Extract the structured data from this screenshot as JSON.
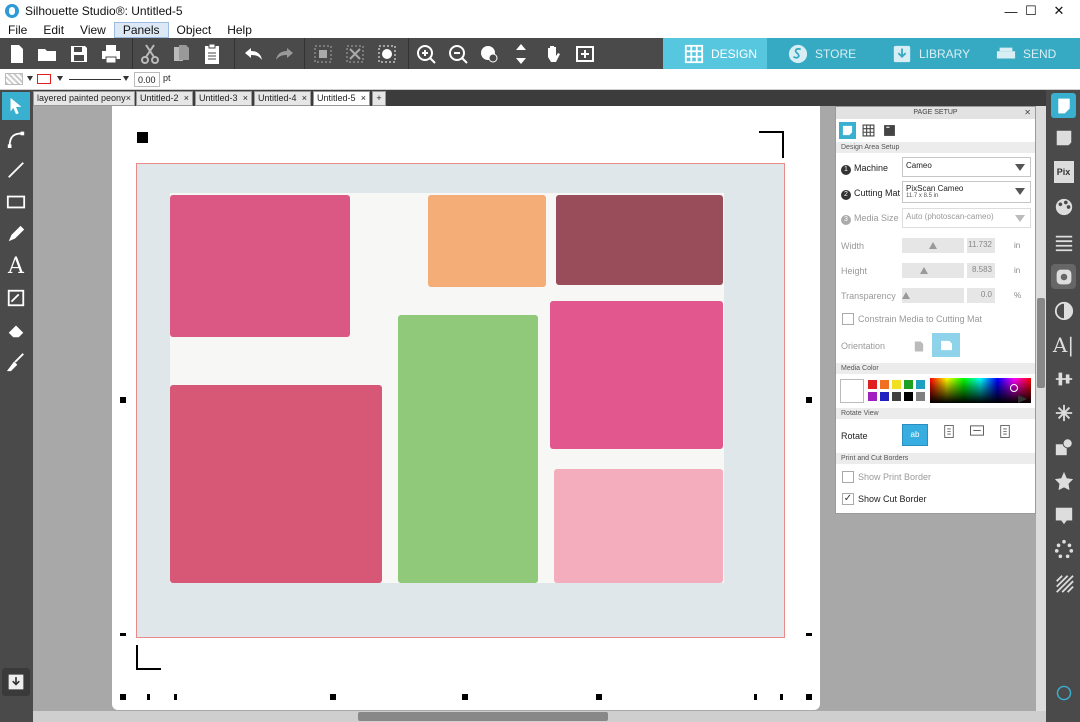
{
  "window": {
    "title": "Silhouette Studio®: Untitled-5",
    "minimize": "—",
    "maximize": "☐",
    "close": "✕"
  },
  "menu": [
    "File",
    "Edit",
    "View",
    "Panels",
    "Object",
    "Help"
  ],
  "nav_tabs": [
    {
      "label": "DESIGN",
      "active": true
    },
    {
      "label": "STORE",
      "active": false
    },
    {
      "label": "LIBRARY",
      "active": false
    },
    {
      "label": "SEND",
      "active": false
    }
  ],
  "line_bar": {
    "line_width": "0.00",
    "unit": "pt"
  },
  "doc_tabs": [
    {
      "label": "layered painted peony"
    },
    {
      "label": "Untitled-2"
    },
    {
      "label": "Untitled-3"
    },
    {
      "label": "Untitled-4"
    },
    {
      "label": "Untitled-5",
      "active": true
    }
  ],
  "doc_tab_close": "×",
  "add_tab": "+",
  "panel": {
    "title": "PAGE SETUP",
    "close": "✕",
    "design_area_setup": "Design Area Setup",
    "machine_label": "Machine",
    "machine_value": "Cameo",
    "cutting_mat_label": "Cutting Mat",
    "cutting_mat_value": "PixScan Cameo",
    "cutting_mat_size": "11.7 x 8.5 in",
    "media_size_label": "Media Size",
    "media_size_value": "Auto (photoscan-cameo)",
    "width_label": "Width",
    "width_value": "11.732",
    "height_label": "Height",
    "height_value": "8.583",
    "in": "in",
    "transparency_label": "Transparency",
    "transparency_value": "0.0",
    "percent": "%",
    "constrain_label": "Constrain Media to Cutting Mat",
    "orientation_label": "Orientation",
    "media_color_section": "Media Color",
    "rotate_view_section": "Rotate View",
    "rotate_label": "Rotate",
    "print_cut_section": "Print and Cut Borders",
    "show_print_border": "Show Print Border",
    "show_cut_border": "Show Cut Border",
    "show_cut_border_checked": true,
    "step_numbers": [
      "1",
      "2",
      "3"
    ],
    "check_mark": "✓"
  },
  "colors": {
    "accent": "#57c7e0",
    "toolbar_bg": "#4a4a4a",
    "swatches": [
      "#ffffff",
      "#e02020",
      "#f07020",
      "#f0e020",
      "#20a020",
      "#20a0c0",
      "#a020c0",
      "#2020c0",
      "#404040",
      "#000000",
      "#808080"
    ],
    "paint": [
      "#d74a78",
      "#f4a46a",
      "#8e3a4a",
      "#86c46e",
      "#e04a84",
      "#d24a6a",
      "#f2a6b6"
    ]
  }
}
